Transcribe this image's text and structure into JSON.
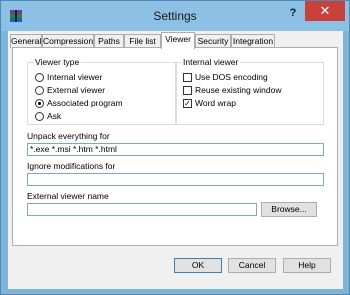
{
  "window": {
    "title": "Settings",
    "help_glyph": "?",
    "close_glyph": "✕"
  },
  "tabs": [
    {
      "label": "General"
    },
    {
      "label": "Compression"
    },
    {
      "label": "Paths"
    },
    {
      "label": "File list"
    },
    {
      "label": "Viewer",
      "active": true
    },
    {
      "label": "Security"
    },
    {
      "label": "Integration"
    }
  ],
  "viewer_type": {
    "title": "Viewer type",
    "options": [
      {
        "label": "Internal viewer",
        "selected": false
      },
      {
        "label": "External viewer",
        "selected": false
      },
      {
        "label": "Associated program",
        "selected": true
      },
      {
        "label": "Ask",
        "selected": false
      }
    ]
  },
  "internal_viewer": {
    "title": "Internal viewer",
    "options": [
      {
        "label": "Use DOS encoding",
        "checked": false
      },
      {
        "label": "Reuse existing window",
        "checked": false
      },
      {
        "label": "Word wrap",
        "checked": true
      }
    ]
  },
  "unpack": {
    "label": "Unpack everything for",
    "value": "*.exe *.msi *.htm *.html"
  },
  "ignore": {
    "label": "Ignore modifications for",
    "value": ""
  },
  "external_viewer": {
    "label": "External viewer name",
    "value": "",
    "browse_label": "Browse..."
  },
  "buttons": {
    "ok": "OK",
    "cancel": "Cancel",
    "help": "Help"
  },
  "colors": {
    "accent": "#7fb4d9",
    "close": "#c7423b"
  }
}
